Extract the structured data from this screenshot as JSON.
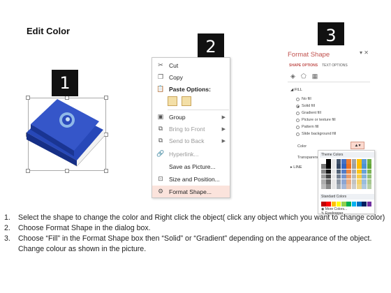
{
  "title": "Edit Color",
  "steps": {
    "one": "1",
    "two": "2",
    "three": "3"
  },
  "context_menu": {
    "cut": "Cut",
    "copy": "Copy",
    "paste_options": "Paste Options:",
    "group": "Group",
    "bring_to_front": "Bring to Front",
    "send_to_back": "Send to Back",
    "hyperlink": "Hyperlink...",
    "save_as_picture": "Save as Picture...",
    "size_and_position": "Size and Position...",
    "format_shape": "Format Shape..."
  },
  "format_shape": {
    "title": "Format Shape",
    "tab_shape": "SHAPE OPTIONS",
    "tab_text": "TEXT OPTIONS",
    "fill": "FILL",
    "options": [
      "No fill",
      "Solid fill",
      "Gradient fill",
      "Picture or texture fill",
      "Pattern fill",
      "Slide background fill"
    ],
    "selected_option": "Solid fill",
    "color_label": "Color",
    "transparency_label": "Transparency",
    "line": "LINE",
    "theme_colors": "Theme Colors",
    "standard_colors": "Standard Colors",
    "more_colors": "More Colors...",
    "eyedropper": "Eyedropper"
  },
  "instructions": [
    {
      "num": "1.",
      "text": "Select the shape to change the color and Right click the object( click any object which you want to change color)"
    },
    {
      "num": "2.",
      "text": "Choose Format Shape in the dialog box."
    },
    {
      "num": "3.",
      "text": "Choose “Fill” in the Format Shape box then “Solid” or “Gradient” depending on the appearance of the object. Change colour as shown in the picture."
    }
  ],
  "colors": {
    "accent": "#c0504d",
    "book_blue": "#1f3fa8",
    "highlight": "#fbe3dc"
  }
}
